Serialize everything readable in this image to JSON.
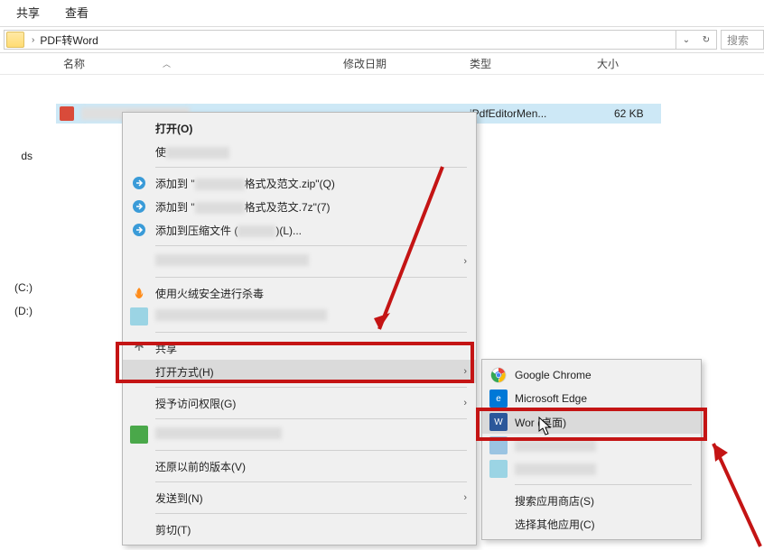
{
  "ribbon": {
    "share": "共享",
    "view": "查看"
  },
  "breadcrumb": {
    "folder": "PDF转Word"
  },
  "search": {
    "placeholder": "搜索"
  },
  "columns": {
    "name": "名称",
    "date": "修改日期",
    "type": "类型",
    "size": "大小"
  },
  "sidebar": {
    "ds": "ds",
    "c": "(C:)",
    "d": "(D:)"
  },
  "file": {
    "type_text": "jPdfEditorMen...",
    "size_text": "62 KB"
  },
  "menu": {
    "open": "打开(O)",
    "use_prefix": "使",
    "add_zip": "添加到",
    "add_zip_suffix": "格式及范文.zip\"(Q)",
    "add_7z": "添加到",
    "add_7z_suffix": "格式及范文.7z\"(7)",
    "add_archive": "添加到压缩文件 (",
    "add_archive_suffix": ")(L)...",
    "scan": "使用火绒安全进行杀毒",
    "share": "共享",
    "open_with": "打开方式(H)",
    "grant_access": "授予访问权限(G)",
    "restore": "还原以前的版本(V)",
    "send_to": "发送到(N)",
    "cut": "剪切(T)"
  },
  "submenu": {
    "chrome": "Google Chrome",
    "edge": "Microsoft Edge",
    "word": "Wor",
    "word_suffix": " (桌面)",
    "store": "搜索应用商店(S)",
    "choose": "选择其他应用(C)"
  }
}
